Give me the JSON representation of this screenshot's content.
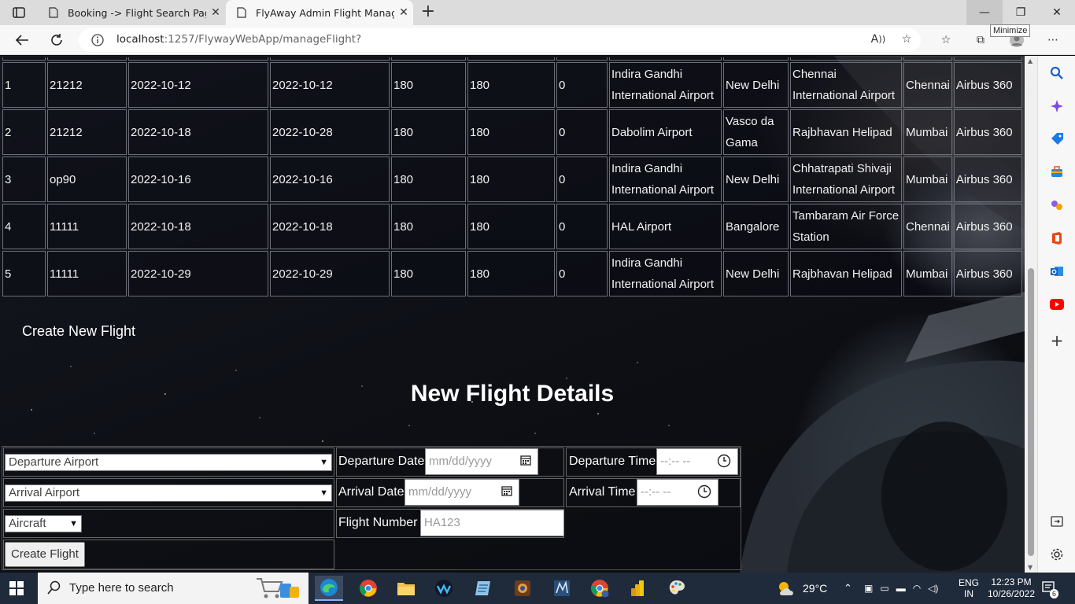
{
  "browser": {
    "tabs": [
      {
        "title": "Booking -> Flight Search Page",
        "active": false
      },
      {
        "title": "FlyAway Admin Flight Manageme",
        "active": true
      }
    ],
    "url_host": "localhost",
    "url_rest": ":1257/FlywayWebApp/manageFlight?",
    "tooltip": "Minimize"
  },
  "flights": {
    "rows": [
      {
        "id": "1",
        "code": "21212",
        "dep_date": "2022-10-12",
        "arr_date": "2022-10-12",
        "c1": "180",
        "c2": "180",
        "c3": "0",
        "dep_airport": "Indira Gandhi International Airport",
        "dep_city": "New Delhi",
        "arr_airport": "Chennai International Airport",
        "arr_city": "Chennai",
        "aircraft": "Airbus 360"
      },
      {
        "id": "2",
        "code": "21212",
        "dep_date": "2022-10-18",
        "arr_date": "2022-10-28",
        "c1": "180",
        "c2": "180",
        "c3": "0",
        "dep_airport": "Dabolim Airport",
        "dep_city": "Vasco da Gama",
        "arr_airport": "Rajbhavan Helipad",
        "arr_city": "Mumbai",
        "aircraft": "Airbus 360"
      },
      {
        "id": "3",
        "code": "op90",
        "dep_date": "2022-10-16",
        "arr_date": "2022-10-16",
        "c1": "180",
        "c2": "180",
        "c3": "0",
        "dep_airport": "Indira Gandhi International Airport",
        "dep_city": "New Delhi",
        "arr_airport": "Chhatrapati Shivaji International Airport",
        "arr_city": "Mumbai",
        "aircraft": "Airbus 360"
      },
      {
        "id": "4",
        "code": "11111",
        "dep_date": "2022-10-18",
        "arr_date": "2022-10-18",
        "c1": "180",
        "c2": "180",
        "c3": "0",
        "dep_airport": "HAL Airport",
        "dep_city": "Bangalore",
        "arr_airport": "Tambaram Air Force Station",
        "arr_city": "Chennai",
        "aircraft": "Airbus 360"
      },
      {
        "id": "5",
        "code": "11111",
        "dep_date": "2022-10-29",
        "arr_date": "2022-10-29",
        "c1": "180",
        "c2": "180",
        "c3": "0",
        "dep_airport": "Indira Gandhi International Airport",
        "dep_city": "New Delhi",
        "arr_airport": "Rajbhavan Helipad",
        "arr_city": "Mumbai",
        "aircraft": "Airbus 360"
      }
    ]
  },
  "create_link": "Create New Flight",
  "form": {
    "title": "New Flight Details",
    "departure_airport": "Departure Airport",
    "arrival_airport": "Arrival Airport",
    "aircraft": "Aircraft",
    "departure_date_label": "Departure Date",
    "arrival_date_label": "Arrival Date",
    "date_placeholder": "mm/dd/yyyy",
    "departure_time_label": "Departure Time",
    "arrival_time_label": "Arrival Time",
    "time_placeholder": "--:-- --",
    "flight_number_label": "Flight Number",
    "flight_number_placeholder": "HA123",
    "submit": "Create Flight"
  },
  "taskbar": {
    "search_placeholder": "Type here to search",
    "weather": "29°C",
    "lang1": "ENG",
    "lang2": "IN",
    "time": "12:23 PM",
    "date": "10/26/2022",
    "notifications": "6"
  }
}
